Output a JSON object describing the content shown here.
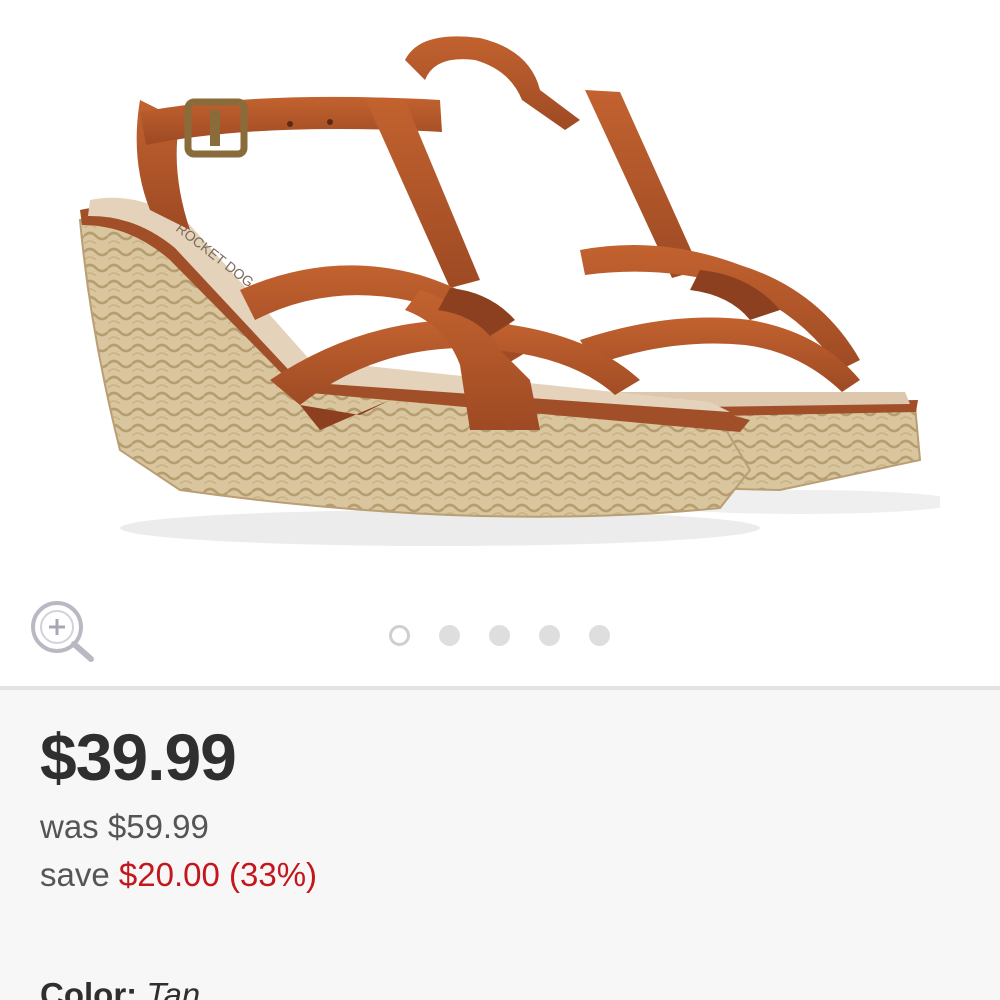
{
  "product": {
    "image_alt": "Tan strappy espadrille wedge sandals",
    "insole_logo": "ROCKET DOG"
  },
  "gallery": {
    "zoom_icon": "zoom-in-icon",
    "dots_count": 5,
    "active_dot_index": 0
  },
  "price": {
    "current": "$39.99",
    "was_label": "was",
    "was_value": "$59.99",
    "save_label": "save",
    "save_value": "$20.00 (33%)"
  },
  "color": {
    "label": "Color:",
    "value": "Tan"
  },
  "colors": {
    "sale_red": "#c4161c",
    "strap_tan": "#b4582e",
    "jute": "#d7c29b"
  }
}
